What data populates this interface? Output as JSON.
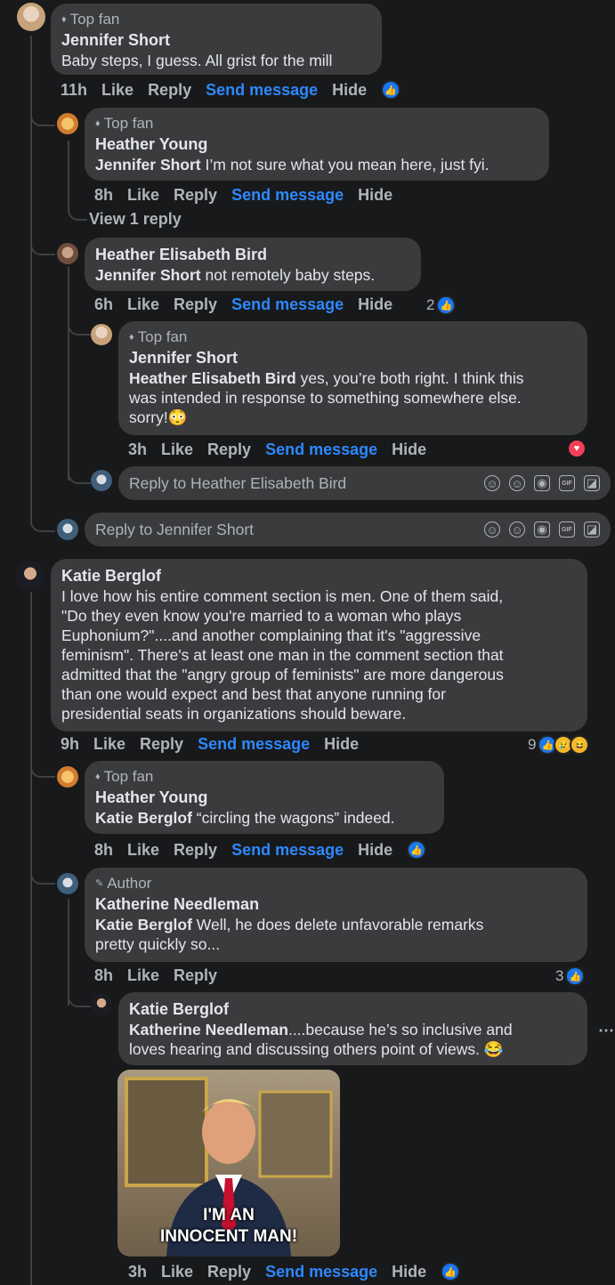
{
  "comments": {
    "c1": {
      "badge": "Top fan",
      "name": "Jennifer Short",
      "text": "Baby steps, I guess. All grist for the mill",
      "time": "11h",
      "like": "Like",
      "reply": "Reply",
      "send": "Send message",
      "hide": "Hide"
    },
    "c2": {
      "badge": "Top fan",
      "name": "Heather Young",
      "mention": "Jennifer Short",
      "text": " I’m not sure what you mean here, just fyi.",
      "time": "8h",
      "like": "Like",
      "reply": "Reply",
      "send": "Send message",
      "hide": "Hide",
      "view_replies": "View 1 reply"
    },
    "c3": {
      "name": "Heather Elisabeth Bird",
      "mention": "Jennifer Short",
      "text": " not remotely baby steps.",
      "time": "6h",
      "like": "Like",
      "reply": "Reply",
      "send": "Send message",
      "hide": "Hide",
      "reaction_count": "2"
    },
    "c4": {
      "badge": "Top fan",
      "name": "Jennifer Short",
      "mention": "Heather Elisabeth Bird",
      "text_line1": " yes, you’re both right. I think this",
      "text_line2": "was intended in response to something somewhere else.",
      "text_line3": "sorry!😳",
      "time": "3h",
      "like": "Like",
      "reply": "Reply",
      "send": "Send message",
      "hide": "Hide"
    },
    "reply_box_1": {
      "placeholder": "Reply to Heather Elisabeth Bird"
    },
    "reply_box_2": {
      "placeholder": "Reply to Jennifer Short"
    },
    "c5": {
      "name": "Katie Berglof",
      "lines": [
        "I love how his entire comment section is men. One of them said,",
        "\"Do they even know you're married to a woman who plays",
        "Euphonium?\"....and another complaining that it's \"aggressive",
        "feminism\". There's at least one man in the comment section that",
        "admitted that the \"angry group of feminists\" are more dangerous",
        "than one would expect and best that anyone running for",
        "presidential seats in organizations should beware."
      ],
      "time": "9h",
      "like": "Like",
      "reply": "Reply",
      "send": "Send message",
      "hide": "Hide",
      "reaction_count": "9"
    },
    "c6": {
      "badge": "Top fan",
      "name": "Heather Young",
      "mention": "Katie Berglof",
      "text": " “circling the wagons” indeed.",
      "time": "8h",
      "like": "Like",
      "reply": "Reply",
      "send": "Send message",
      "hide": "Hide"
    },
    "c7": {
      "badge": "Author",
      "name": "Katherine Needleman",
      "mention": "Katie Berglof",
      "text_line1": " Well, he does delete unfavorable remarks",
      "text_line2": "pretty quickly so...",
      "time": "8h",
      "like": "Like",
      "reply": "Reply",
      "reaction_count": "3"
    },
    "c8": {
      "name": "Katie Berglof",
      "mention": "Katherine Needleman",
      "text_line1": "....because he’s so inclusive and",
      "text_line2": "loves hearing and discussing others point of views. 😂",
      "gif_caption_line1": "I'M AN",
      "gif_caption_line2": "INNOCENT MAN!",
      "time": "3h",
      "like": "Like",
      "reply": "Reply",
      "send": "Send message",
      "hide": "Hide"
    }
  },
  "icons": [
    "like-icon",
    "heart-icon",
    "haha-icon",
    "sad-icon",
    "avatar-icon",
    "camera-icon",
    "gif-icon",
    "sticker-icon",
    "smile-icon",
    "more-icon"
  ],
  "colors": {
    "background": "#18191a",
    "bubble": "#3a3b3c",
    "link": "#2d88ff",
    "like": "#1877f2",
    "heart": "#f33e58"
  }
}
